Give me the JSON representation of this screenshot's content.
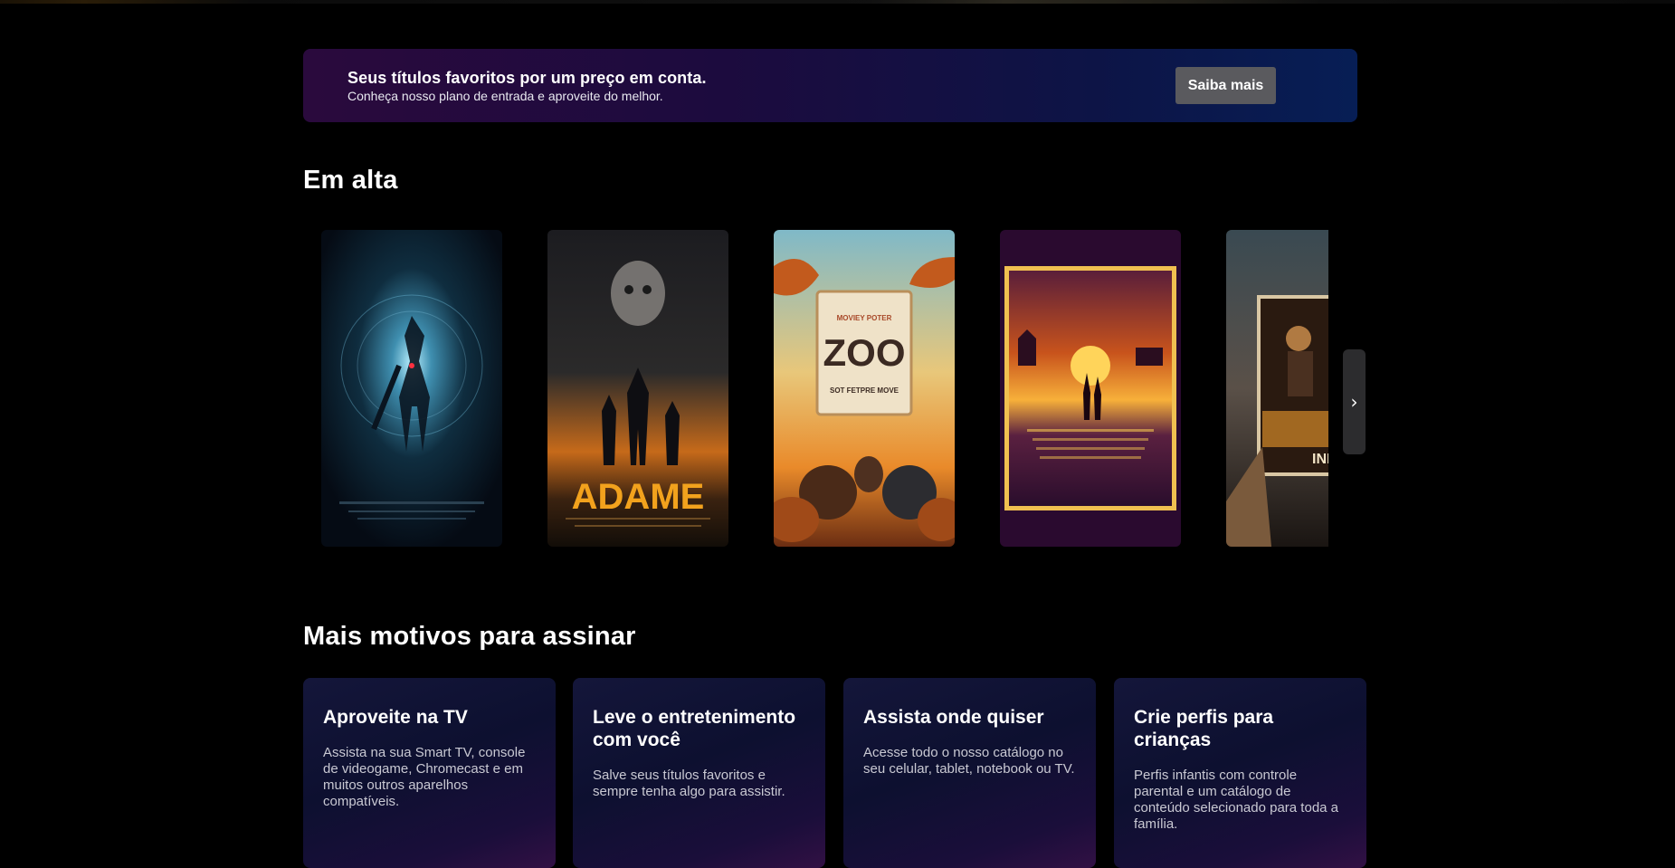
{
  "promo": {
    "title": "Seus títulos favoritos por um preço em conta.",
    "subtitle": "Conheça nosso plano de entrada e aproveite do melhor.",
    "button_label": "Saiba mais"
  },
  "trending": {
    "title": "Em alta",
    "posters": [
      {
        "name": "scifi-warrior",
        "caption": "S A  G C R"
      },
      {
        "name": "adame",
        "caption": "ADAME"
      },
      {
        "name": "zoo",
        "caption": "ZOO",
        "sub1": "MOVIEY POTER",
        "sub2": "SOT FETPRE MOVE"
      },
      {
        "name": "western-sunset",
        "caption": ""
      },
      {
        "name": "india-bo",
        "caption": "INDIA BO"
      }
    ],
    "next_icon": "chevron-right-icon"
  },
  "reasons": {
    "title": "Mais motivos para assinar",
    "cards": [
      {
        "title": "Aproveite na TV",
        "text": "Assista na sua Smart TV, console de videogame, Chromecast e em muitos outros aparelhos compatíveis."
      },
      {
        "title": "Leve o entretenimento com você",
        "text": "Salve seus títulos favoritos e sempre tenha algo para assistir."
      },
      {
        "title": "Assista onde quiser",
        "text": "Acesse todo o nosso catálogo no seu celular, tablet, notebook ou TV."
      },
      {
        "title": "Crie perfis para crianças",
        "text": "Perfis infantis com controle parental e um catálogo de conteúdo selecionado para toda a família."
      }
    ]
  },
  "colors": {
    "background": "#000000",
    "promo_gradient_start": "#2a0a3d",
    "promo_gradient_end": "#071e55",
    "button_bg": "#5a5a5e"
  }
}
